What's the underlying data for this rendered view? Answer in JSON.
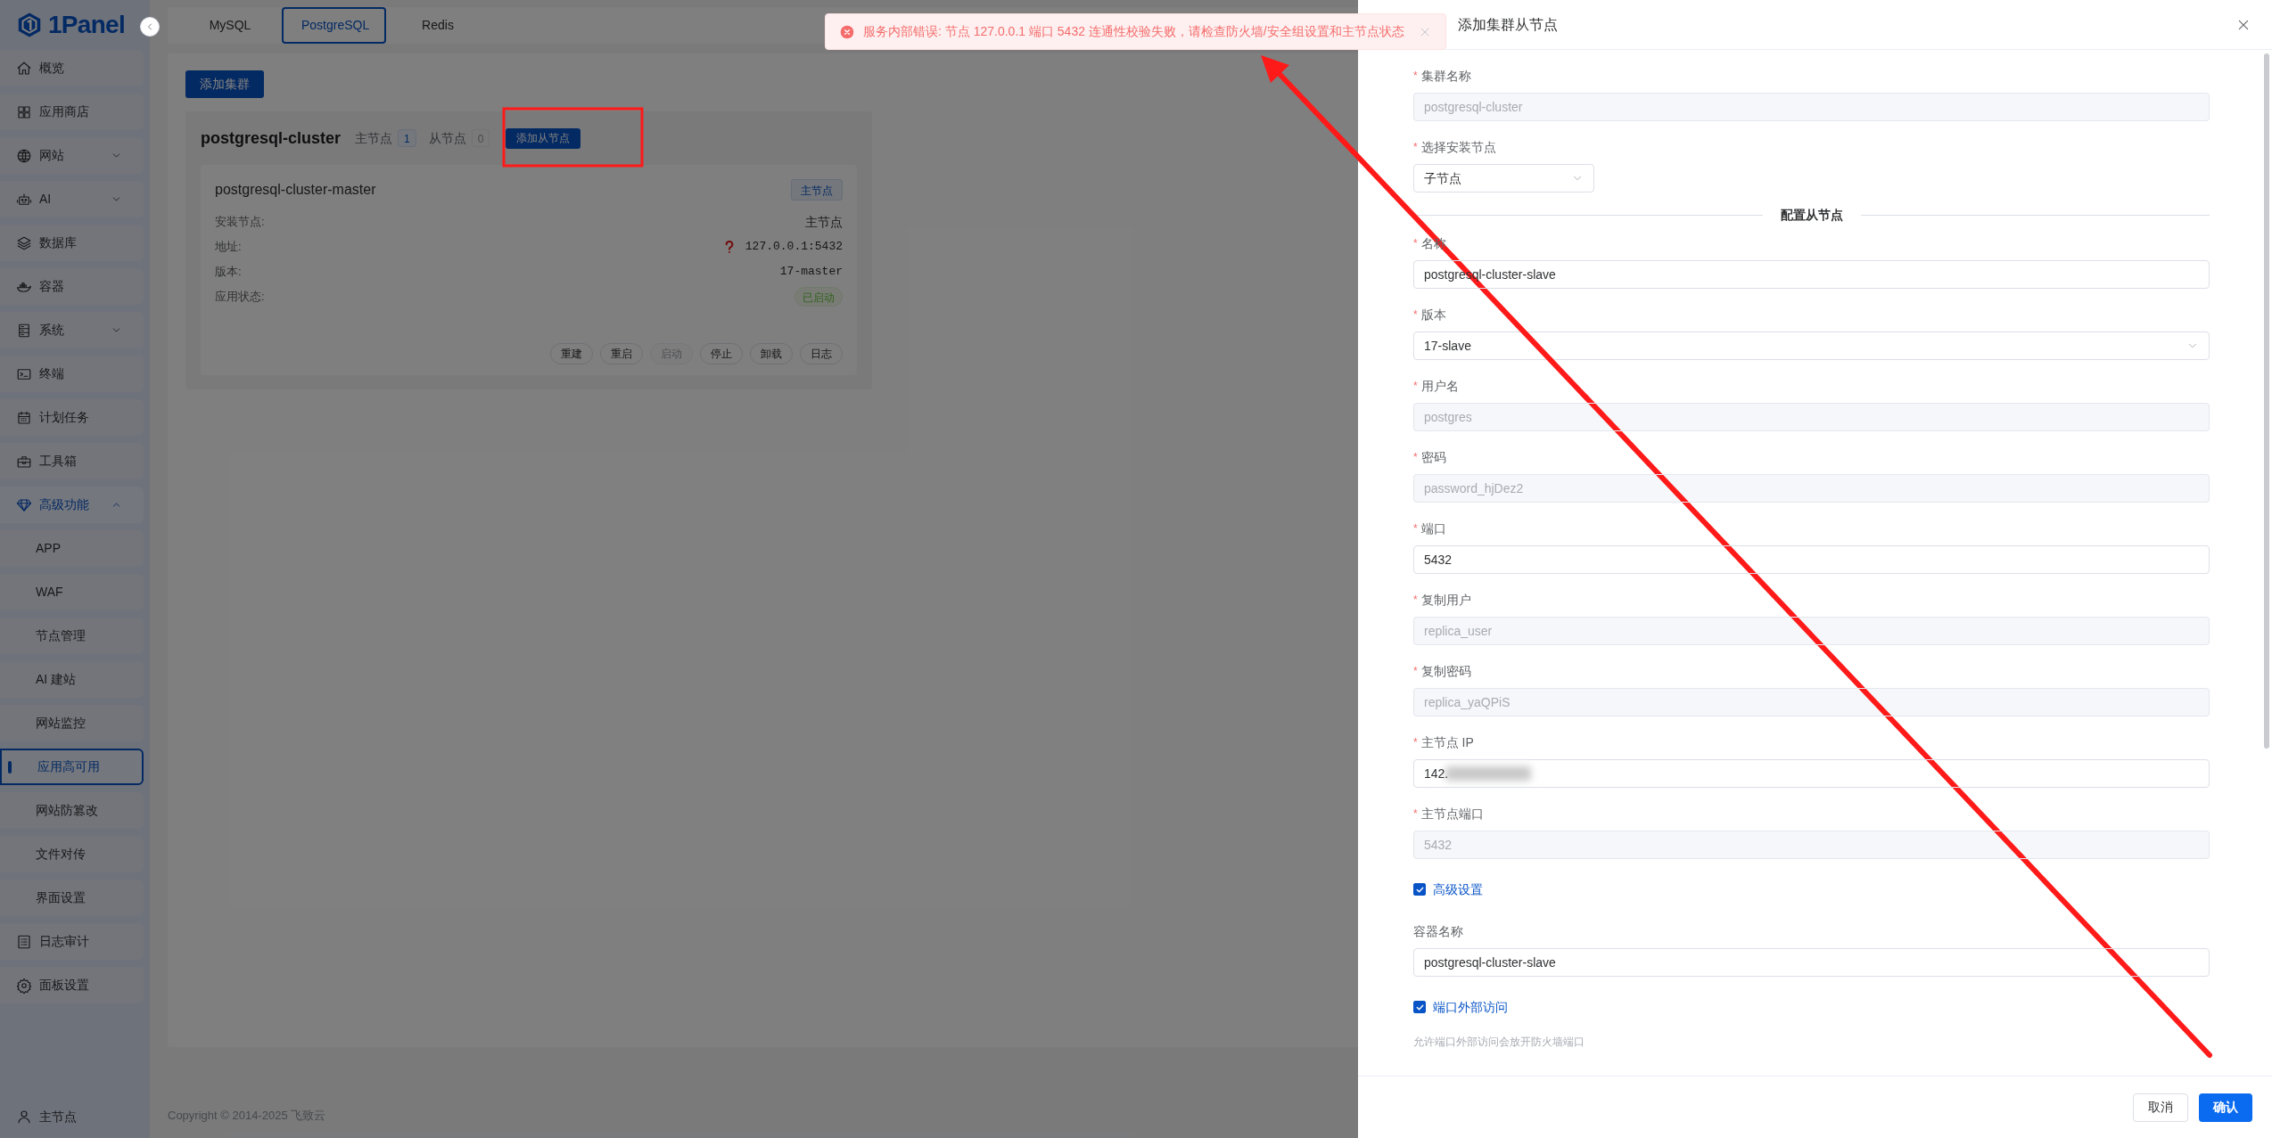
{
  "logo": {
    "text": "1Panel"
  },
  "sidebar": {
    "items": [
      {
        "label": "概览",
        "kind": "link",
        "selected": false
      },
      {
        "label": "应用商店",
        "kind": "link",
        "selected": false
      },
      {
        "label": "网站",
        "kind": "group",
        "expanded": false,
        "selected": false
      },
      {
        "label": "AI",
        "kind": "group",
        "expanded": false,
        "selected": false
      },
      {
        "label": "数据库",
        "kind": "link",
        "selected": false
      },
      {
        "label": "容器",
        "kind": "link",
        "selected": false
      },
      {
        "label": "系统",
        "kind": "group",
        "expanded": false,
        "selected": false
      },
      {
        "label": "终端",
        "kind": "link",
        "selected": false
      },
      {
        "label": "计划任务",
        "kind": "link",
        "selected": false
      },
      {
        "label": "工具箱",
        "kind": "link",
        "selected": false
      },
      {
        "label": "高级功能",
        "kind": "group",
        "expanded": true,
        "selected": true,
        "children": [
          {
            "label": "APP",
            "selected": false
          },
          {
            "label": "WAF",
            "selected": false
          },
          {
            "label": "节点管理",
            "selected": false
          },
          {
            "label": "AI 建站",
            "selected": false
          },
          {
            "label": "网站监控",
            "selected": false
          },
          {
            "label": "应用高可用",
            "selected": true
          },
          {
            "label": "网站防篡改",
            "selected": false
          },
          {
            "label": "文件对传",
            "selected": false
          },
          {
            "label": "界面设置",
            "selected": false
          }
        ]
      },
      {
        "label": "日志审计",
        "kind": "link",
        "selected": false
      },
      {
        "label": "面板设置",
        "kind": "link",
        "selected": false
      }
    ],
    "user": "主节点"
  },
  "tabs": [
    {
      "label": "MySQL",
      "selected": false
    },
    {
      "label": "PostgreSQL",
      "selected": true
    },
    {
      "label": "Redis",
      "selected": false
    }
  ],
  "add_cluster_button": "添加集群",
  "cluster": {
    "name": "postgresql-cluster",
    "master_label": "主节点",
    "master_count": "1",
    "slave_label": "从节点",
    "slave_count": "0",
    "add_slave_button": "添加从节点",
    "node": {
      "title": "postgresql-cluster-master",
      "tag": "主节点",
      "fields": [
        {
          "label": "安装节点:",
          "value": "主节点",
          "kind": "text"
        },
        {
          "label": "地址:",
          "value": "127.0.0.1:5432",
          "kind": "address"
        },
        {
          "label": "版本:",
          "value": "17-master",
          "kind": "mono"
        },
        {
          "label": "应用状态:",
          "value": "已启动",
          "kind": "status"
        }
      ],
      "actions": [
        {
          "label": "重建",
          "disabled": false
        },
        {
          "label": "重启",
          "disabled": false
        },
        {
          "label": "启动",
          "disabled": true
        },
        {
          "label": "停止",
          "disabled": false
        },
        {
          "label": "卸载",
          "disabled": false
        },
        {
          "label": "日志",
          "disabled": false
        }
      ]
    }
  },
  "footer": "Copyright © 2014-2025 飞致云",
  "toast": {
    "kind": "error",
    "message": "服务内部错误: 节点 127.0.0.1 端口 5432 连通性校验失败，请检查防火墙/安全组设置和主节点状态"
  },
  "drawer": {
    "title": "添加集群从节点",
    "fields": [
      {
        "kind": "input",
        "marker": "*",
        "label": "集群名称",
        "value": "postgresql-cluster",
        "disabled": true
      },
      {
        "kind": "short_select",
        "marker": "*",
        "label": "选择安装节点",
        "value": "子节点"
      },
      {
        "kind": "divider",
        "label": "配置从节点"
      },
      {
        "kind": "input",
        "marker": "*",
        "label": "名称",
        "value": "postgresql-cluster-slave",
        "disabled": false
      },
      {
        "kind": "select",
        "marker": "*",
        "label": "版本",
        "value": "17-slave"
      },
      {
        "kind": "input",
        "marker": "*",
        "label": "用户名",
        "value": "postgres",
        "disabled": true
      },
      {
        "kind": "input",
        "marker": "*",
        "label": "密码",
        "value": "password_hjDez2",
        "disabled": true
      },
      {
        "kind": "input",
        "marker": "*",
        "label": "端口",
        "value": "5432",
        "disabled": false
      },
      {
        "kind": "input",
        "marker": "*",
        "label": "复制用户",
        "value": "replica_user",
        "disabled": true
      },
      {
        "kind": "input",
        "marker": "*",
        "label": "复制密码",
        "value": "replica_yaQPiS",
        "disabled": true
      },
      {
        "kind": "input",
        "marker": "*",
        "label": "主节点 IP",
        "value": "142.",
        "disabled": false,
        "redacted": true
      },
      {
        "kind": "input",
        "marker": "*",
        "label": "主节点端口",
        "value": "5432",
        "disabled": true
      },
      {
        "kind": "checkbox",
        "label": "高级设置",
        "checked": true
      },
      {
        "kind": "input",
        "label": "容器名称",
        "value": "postgresql-cluster-slave",
        "disabled": false
      },
      {
        "kind": "checkbox",
        "label": "端口外部访问",
        "checked": true
      },
      {
        "kind": "hint",
        "label": "允许端口外部访问会放开防火墙端口"
      }
    ],
    "buttons": [
      {
        "label": "取消",
        "primary": false
      },
      {
        "label": "确认",
        "primary": true
      }
    ]
  }
}
